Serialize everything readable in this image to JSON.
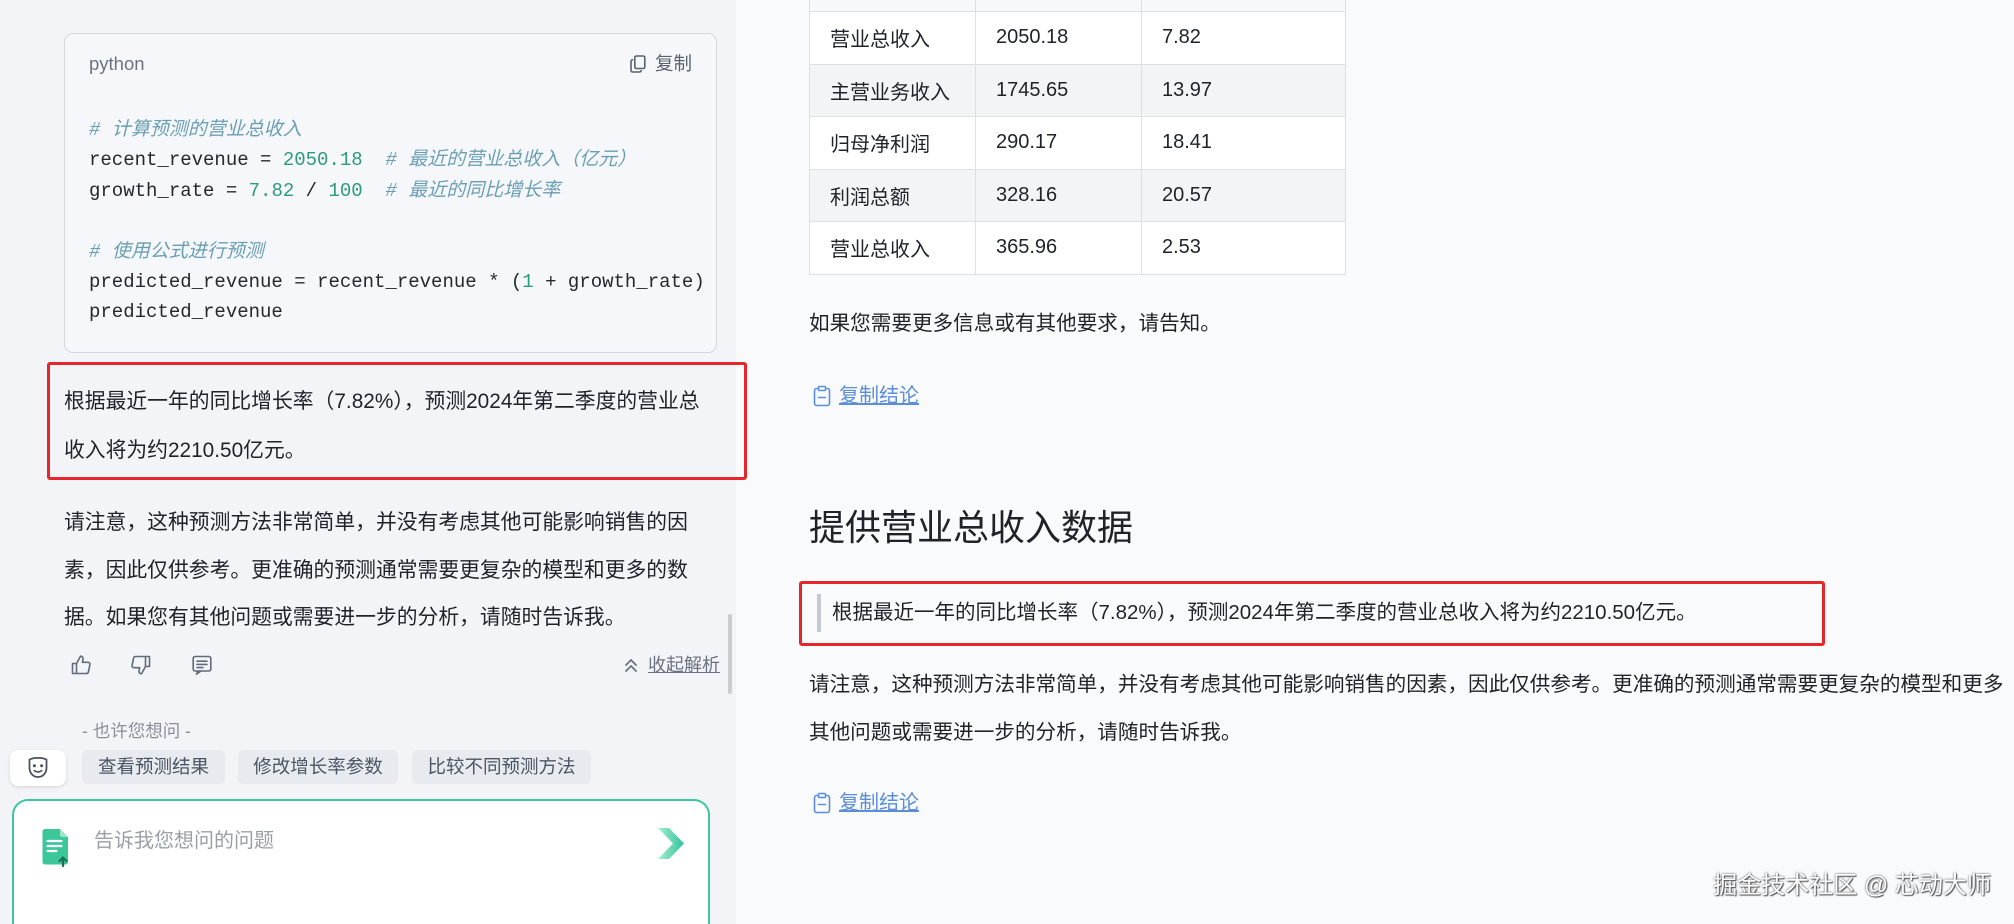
{
  "colors": {
    "accent": "#3ec6a1",
    "highlight_red": "#e5262b",
    "link": "#5b8dd9"
  },
  "left_panel": {
    "code_block": {
      "language": "python",
      "copy_label": "复制",
      "lines": [
        [
          {
            "text": "# 计算预测的营业总收入",
            "color": "#6a9fb3",
            "italic": true
          }
        ],
        [
          {
            "text": "recent_revenue = ",
            "color": "#24292f"
          },
          {
            "text": "2050.18",
            "color": "#2e9b78"
          },
          {
            "text": "  ",
            "color": "#24292f"
          },
          {
            "text": "# 最近的营业总收入（亿元）",
            "color": "#6a9fb3",
            "italic": true
          }
        ],
        [
          {
            "text": "growth_rate = ",
            "color": "#24292f"
          },
          {
            "text": "7.82",
            "color": "#2e9b78"
          },
          {
            "text": " / ",
            "color": "#24292f"
          },
          {
            "text": "100",
            "color": "#2e9b78"
          },
          {
            "text": "  ",
            "color": "#24292f"
          },
          {
            "text": "# 最近的同比增长率",
            "color": "#6a9fb3",
            "italic": true
          }
        ],
        [],
        [
          {
            "text": "# 使用公式进行预测",
            "color": "#6a9fb3",
            "italic": true
          }
        ],
        [
          {
            "text": "predicted_revenue = recent_revenue * (",
            "color": "#24292f"
          },
          {
            "text": "1",
            "color": "#2e9b78"
          },
          {
            "text": " + growth_rate)",
            "color": "#24292f"
          }
        ],
        [
          {
            "text": "predicted_revenue",
            "color": "#24292f"
          }
        ]
      ]
    },
    "conclusion_lines": [
      "根据最近一年的同比增长率（7.82%），预测2024年第二季度的营业总",
      "收入将为约2210.50亿元。"
    ],
    "note_lines": [
      "请注意，这种预测方法非常简单，并没有考虑其他可能影响销售的因",
      "素，因此仅供参考。更准确的预测通常需要更复杂的模型和更多的数",
      "据。如果您有其他问题或需要进一步的分析，请随时告诉我。"
    ],
    "actions": {
      "collapse_label": "收起解析"
    },
    "suggestions": {
      "title": "- 也许您想问 -",
      "chips": [
        "查看预测结果",
        "修改增长率参数",
        "比较不同预测方法"
      ]
    },
    "input": {
      "placeholder": "告诉我您想问的问题"
    }
  },
  "right_panel": {
    "table": {
      "rows": [
        [
          "营业总收入",
          "2050.18",
          "7.82"
        ],
        [
          "主营业务收入",
          "1745.65",
          "13.97"
        ],
        [
          "归母净利润",
          "290.17",
          "18.41"
        ],
        [
          "利润总额",
          "328.16",
          "20.57"
        ],
        [
          "营业总收入",
          "365.96",
          "2.53"
        ]
      ]
    },
    "closing_text": "如果您需要更多信息或有其他要求，请告知。",
    "copy_conclusion_label": "复制结论",
    "heading": "提供营业总收入数据",
    "quote": "根据最近一年的同比增长率（7.82%），预测2024年第二季度的营业总收入将为约2210.50亿元。",
    "note_lines": [
      "请注意，这种预测方法非常简单，并没有考虑其他可能影响销售的因素，因此仅供参考。更准确的预测通常需要更复杂的模型和更多",
      "其他问题或需要进一步的分析，请随时告诉我。"
    ],
    "copy_conclusion_label_2": "复制结论"
  },
  "watermark": "掘金技术社区 @ 芯动大师"
}
